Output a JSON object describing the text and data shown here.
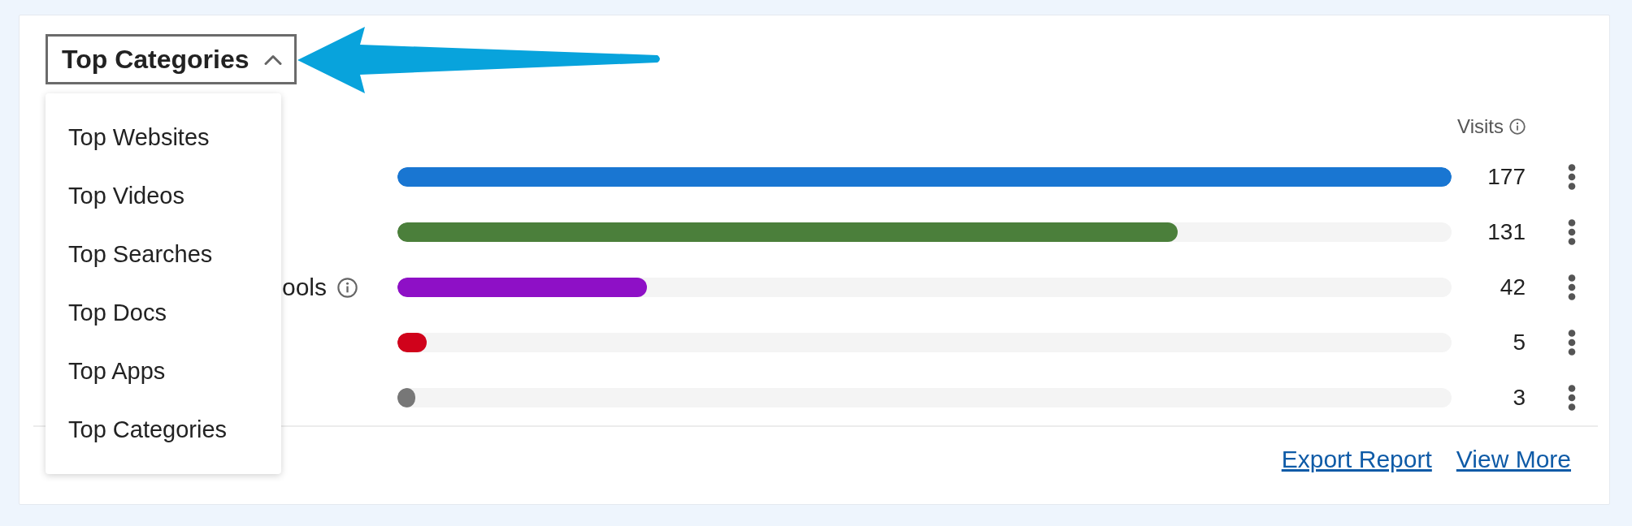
{
  "dropdown": {
    "label": "Top Categories",
    "expanded": true,
    "options": [
      {
        "label": "Top Websites",
        "selected": false
      },
      {
        "label": "Top Videos",
        "selected": false
      },
      {
        "label": "Top Searches",
        "selected": false
      },
      {
        "label": "Top Docs",
        "selected": false
      },
      {
        "label": "Top Apps",
        "selected": false
      },
      {
        "label": "Top Categories",
        "selected": false
      }
    ]
  },
  "table": {
    "visits_header": "Visits",
    "rows": [
      {
        "value": "177",
        "level": 1,
        "color": "#1976d2",
        "info": false
      },
      {
        "value": "131",
        "level": 0.74,
        "color": "#4b7f3b",
        "info": false
      },
      {
        "label": "ools",
        "value": "42",
        "level": 0.237,
        "color": "#8e10c6",
        "info": true
      },
      {
        "value": "5",
        "level": 0.028,
        "color": "#d0021b",
        "info": false
      },
      {
        "value": "3",
        "level": 0.017,
        "color": "#777777",
        "info": false
      }
    ]
  },
  "footer_links": [
    "Export Report",
    "View More"
  ]
}
